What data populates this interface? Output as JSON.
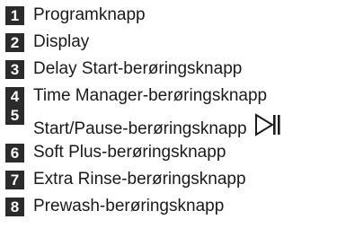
{
  "items": [
    {
      "number": "1",
      "label": "Programknapp"
    },
    {
      "number": "2",
      "label": "Display"
    },
    {
      "number": "3",
      "label": "Delay Start-berøringsknapp"
    },
    {
      "number": "4",
      "label": "Time Manager-berøringsknapp"
    },
    {
      "number": "5",
      "label": "Start/Pause-berøringsknapp",
      "icon": "play-pause-icon"
    },
    {
      "number": "6",
      "label": "Soft Plus-berøringsknapp"
    },
    {
      "number": "7",
      "label": "Extra Rinse-berøringsknapp"
    },
    {
      "number": "8",
      "label": "Prewash-berøringsknapp"
    }
  ]
}
